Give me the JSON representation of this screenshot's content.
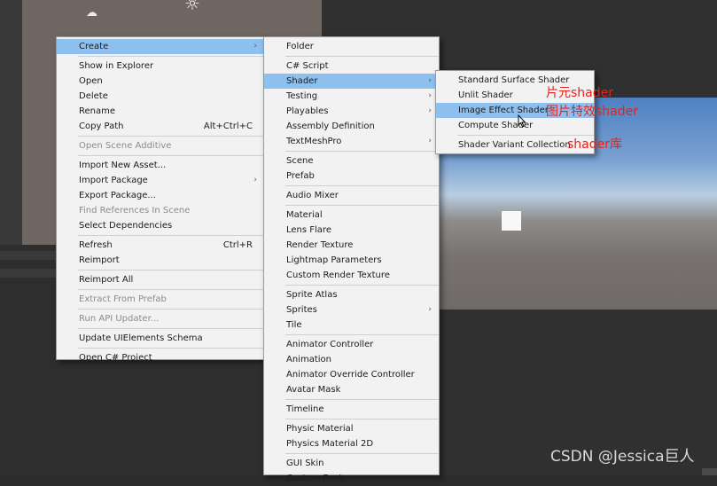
{
  "icons": {
    "cloud": "cloud-icon",
    "sun": "sun-icon",
    "cursor": "mouse-cursor-icon",
    "submenu": "chevron-right-icon"
  },
  "menu_main": {
    "items": [
      {
        "label": "Create",
        "arrow": true,
        "highlighted": true
      },
      {
        "label": "Show in Explorer"
      },
      {
        "label": "Open"
      },
      {
        "label": "Delete"
      },
      {
        "label": "Rename"
      },
      {
        "label": "Copy Path",
        "shortcut": "Alt+Ctrl+C"
      },
      {
        "label": "Open Scene Additive",
        "disabled": true
      },
      {
        "label": "Import New Asset..."
      },
      {
        "label": "Import Package",
        "arrow": true
      },
      {
        "label": "Export Package..."
      },
      {
        "label": "Find References In Scene",
        "disabled": true
      },
      {
        "label": "Select Dependencies"
      },
      {
        "label": "Refresh",
        "shortcut": "Ctrl+R"
      },
      {
        "label": "Reimport"
      },
      {
        "label": "Reimport All"
      },
      {
        "label": "Extract From Prefab",
        "disabled": true
      },
      {
        "label": "Run API Updater...",
        "disabled": true
      },
      {
        "label": "Update UIElements Schema"
      },
      {
        "label": "Open C# Project"
      }
    ]
  },
  "menu_create": {
    "items": [
      {
        "label": "Folder"
      },
      {
        "label": "C# Script"
      },
      {
        "label": "Shader",
        "arrow": true,
        "highlighted": true
      },
      {
        "label": "Testing",
        "arrow": true
      },
      {
        "label": "Playables",
        "arrow": true
      },
      {
        "label": "Assembly Definition"
      },
      {
        "label": "TextMeshPro",
        "arrow": true
      },
      {
        "label": "Scene"
      },
      {
        "label": "Prefab"
      },
      {
        "label": "Audio Mixer"
      },
      {
        "label": "Material"
      },
      {
        "label": "Lens Flare"
      },
      {
        "label": "Render Texture"
      },
      {
        "label": "Lightmap Parameters"
      },
      {
        "label": "Custom Render Texture"
      },
      {
        "label": "Sprite Atlas"
      },
      {
        "label": "Sprites",
        "arrow": true
      },
      {
        "label": "Tile"
      },
      {
        "label": "Animator Controller"
      },
      {
        "label": "Animation"
      },
      {
        "label": "Animator Override Controller"
      },
      {
        "label": "Avatar Mask"
      },
      {
        "label": "Timeline"
      },
      {
        "label": "Physic Material"
      },
      {
        "label": "Physics Material 2D"
      },
      {
        "label": "GUI Skin"
      },
      {
        "label": "Custom Font"
      }
    ]
  },
  "menu_shader": {
    "items": [
      {
        "label": "Standard Surface Shader"
      },
      {
        "label": "Unlit Shader"
      },
      {
        "label": "Image Effect Shader",
        "highlighted": true
      },
      {
        "label": "Compute Shader"
      },
      {
        "label": "Shader Variant Collection"
      }
    ]
  },
  "annotations": {
    "unlit": "片元shader",
    "image_effect": "图片特效shader",
    "variant": "shader库"
  },
  "watermark": "CSDN @Jessica巨人",
  "colors": {
    "highlight": "#8ec0ef",
    "annotation": "#e8221a",
    "menu_bg": "#f2f2f2"
  }
}
